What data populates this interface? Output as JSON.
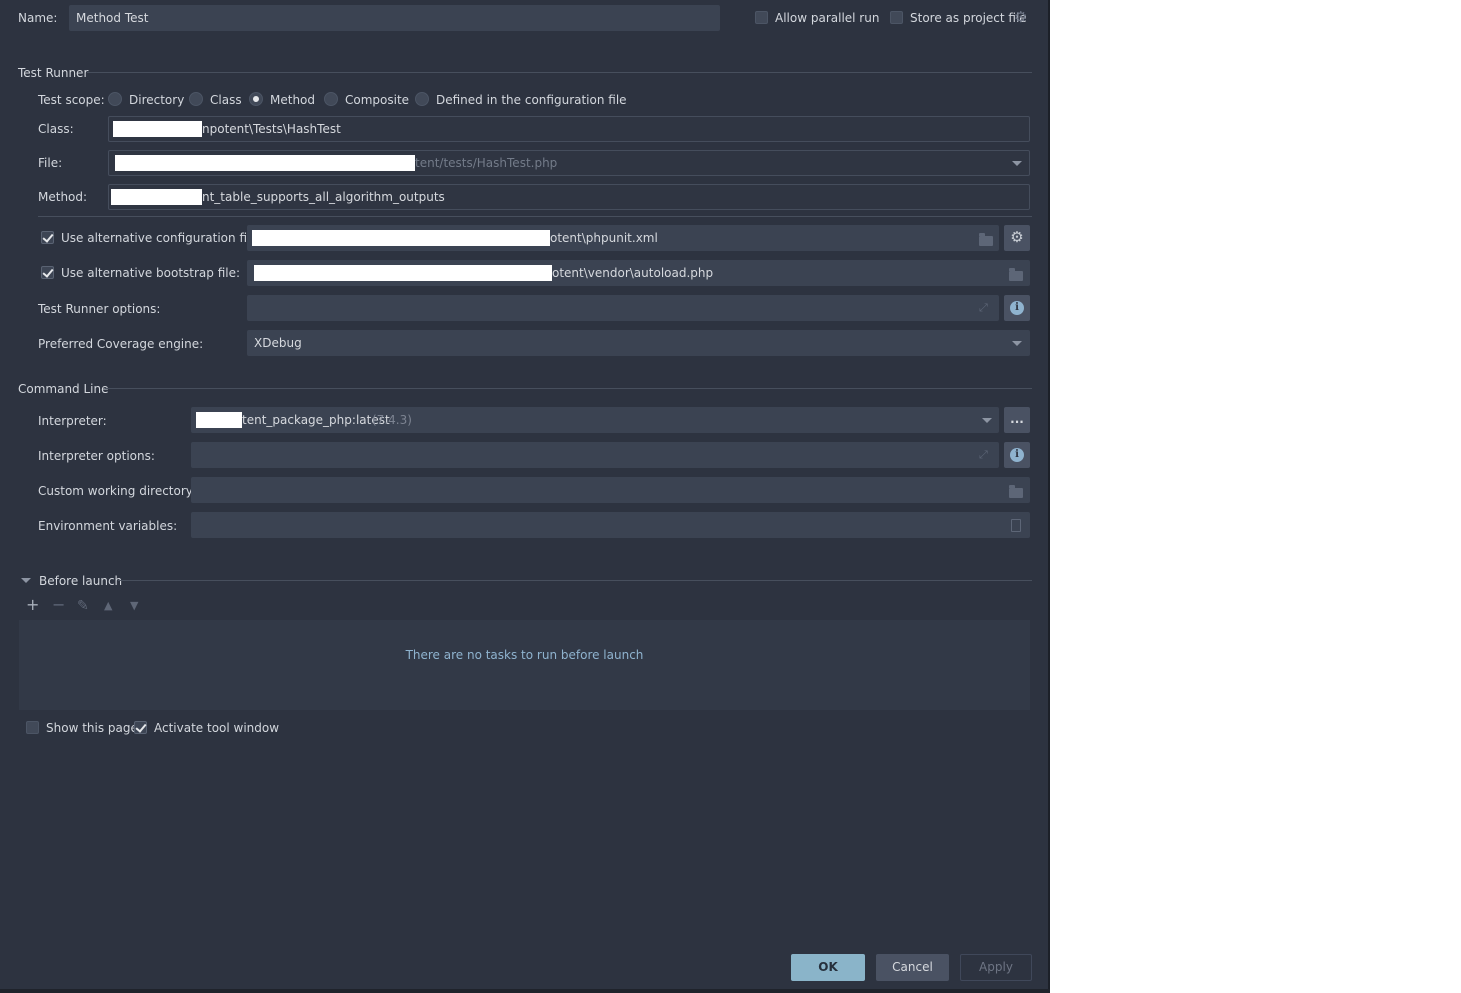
{
  "header": {
    "name_label": "Name:",
    "name_value": "Method Test",
    "allow_parallel_label": "Allow parallel run",
    "allow_parallel_checked": false,
    "store_project_label": "Store as project file",
    "store_project_checked": false,
    "settings_icon": "gear-icon"
  },
  "test_runner": {
    "section_title": "Test Runner",
    "scope_label": "Test scope:",
    "scope_options": [
      "Directory",
      "Class",
      "Method",
      "Composite",
      "Defined in the configuration file"
    ],
    "scope_selected": "Method",
    "class_label": "Class:",
    "class_value": "npotent\\Tests\\HashTest",
    "file_label": "File:",
    "file_value": "tent/tests/HashTest.php",
    "method_label": "Method:",
    "method_value": "nt_table_supports_all_algorithm_outputs",
    "alt_config_label": "Use alternative configuration file:",
    "alt_config_checked": true,
    "alt_config_value": "otent\\phpunit.xml",
    "alt_bootstrap_label": "Use alternative bootstrap file:",
    "alt_bootstrap_checked": true,
    "alt_bootstrap_value": "otent\\vendor\\autoload.php",
    "runner_options_label": "Test Runner options:",
    "runner_options_value": "",
    "coverage_label": "Preferred Coverage engine:",
    "coverage_value": "XDebug"
  },
  "command_line": {
    "section_title": "Command Line",
    "interpreter_label": "Interpreter:",
    "interpreter_value": "tent_package_php:latest",
    "interpreter_version": "(7.4.3)",
    "interpreter_more": "...",
    "interpreter_options_label": "Interpreter options:",
    "interpreter_options_value": "",
    "working_dir_label": "Custom working directory:",
    "working_dir_value": "",
    "env_vars_label": "Environment variables:",
    "env_vars_value": ""
  },
  "before_launch": {
    "section_title": "Before launch",
    "empty_text": "There are no tasks to run before launch",
    "toolbar_icons": [
      "plus-icon",
      "minus-icon",
      "pencil-icon",
      "arrow-up-icon",
      "arrow-down-icon"
    ]
  },
  "footer": {
    "show_page_label": "Show this page",
    "show_page_checked": false,
    "activate_tool_label": "Activate tool window",
    "activate_tool_checked": true
  },
  "buttons": {
    "ok": "OK",
    "cancel": "Cancel",
    "apply": "Apply"
  },
  "colors": {
    "background": "#2d3340",
    "field": "#3b4352",
    "accent_button": "#8ab4c9",
    "info_text": "#8fb3cf"
  }
}
